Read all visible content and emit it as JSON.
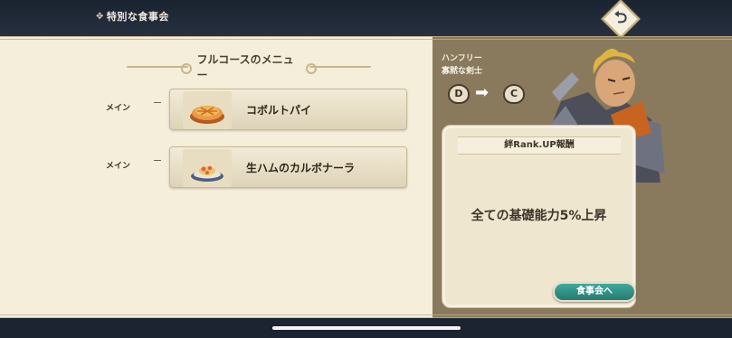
{
  "screen": {
    "title": "特別な食事会",
    "title_icon": "flower-ornament-icon",
    "back_icon": "return-arrow-icon"
  },
  "menu": {
    "header": "フルコースのメニュー",
    "courses": [
      {
        "type": "メイン",
        "dish": "コボルトパイ",
        "icon": "pie-icon"
      },
      {
        "type": "メイン",
        "dish": "生ハムのカルボナーラ",
        "icon": "carbonara-plate-icon"
      }
    ]
  },
  "character": {
    "name": "ハンフリー",
    "title": "寡黙な剣士",
    "rank_from": "D",
    "rank_to": "C"
  },
  "reward": {
    "header": "絆Rank.UP報酬",
    "text": "全ての基礎能力5%上昇"
  },
  "button": {
    "feast": "食事会へ"
  },
  "colors": {
    "left_panel": "#f4eedb",
    "right_panel": "#8a7a5d",
    "accent_button": "#2f8f84",
    "top_bar": "#1a2330"
  }
}
